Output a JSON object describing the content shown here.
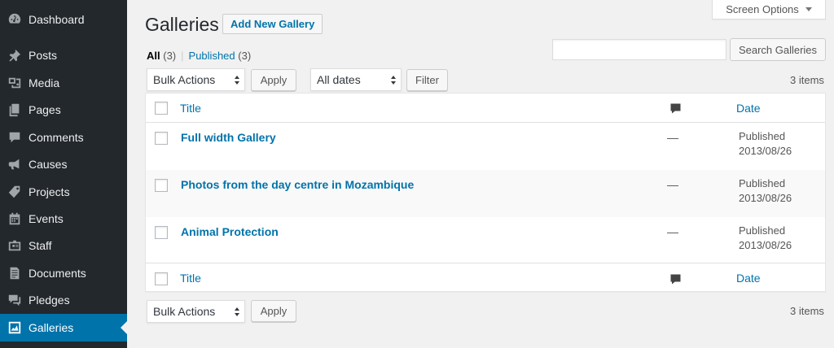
{
  "sidebar": {
    "items": [
      {
        "label": "Dashboard",
        "icon": "dashboard-icon",
        "active": false
      },
      {
        "label": "Posts",
        "icon": "pin-icon",
        "active": false
      },
      {
        "label": "Media",
        "icon": "media-icon",
        "active": false
      },
      {
        "label": "Pages",
        "icon": "pages-icon",
        "active": false
      },
      {
        "label": "Comments",
        "icon": "comment-icon",
        "active": false
      },
      {
        "label": "Causes",
        "icon": "megaphone-icon",
        "active": false
      },
      {
        "label": "Projects",
        "icon": "tag-icon",
        "active": false
      },
      {
        "label": "Events",
        "icon": "calendar-icon",
        "active": false
      },
      {
        "label": "Staff",
        "icon": "id-card-icon",
        "active": false
      },
      {
        "label": "Documents",
        "icon": "document-icon",
        "active": false
      },
      {
        "label": "Pledges",
        "icon": "chat-icon",
        "active": false
      },
      {
        "label": "Galleries",
        "icon": "chart-icon",
        "active": true
      }
    ]
  },
  "screen_options": {
    "label": "Screen Options"
  },
  "header": {
    "title": "Galleries",
    "add_new_label": "Add New Gallery"
  },
  "filters": {
    "all_label": "All",
    "all_count": "(3)",
    "separator": "|",
    "published_label": "Published",
    "published_count": "(3)"
  },
  "search": {
    "placeholder": "",
    "button_label": "Search Galleries"
  },
  "tablenav_top": {
    "bulk_actions": "Bulk Actions",
    "apply_label": "Apply",
    "dates_select": "All dates",
    "filter_label": "Filter",
    "items_count": "3 items"
  },
  "table": {
    "columns": {
      "title": "Title",
      "date": "Date"
    },
    "rows": [
      {
        "title": "Full width Gallery",
        "comments": "—",
        "status": "Published",
        "date": "2013/08/26"
      },
      {
        "title": "Photos from the day centre in Mozambique",
        "comments": "—",
        "status": "Published",
        "date": "2013/08/26"
      },
      {
        "title": "Animal Protection",
        "comments": "—",
        "status": "Published",
        "date": "2013/08/26"
      }
    ]
  },
  "tablenav_bottom": {
    "bulk_actions": "Bulk Actions",
    "apply_label": "Apply",
    "items_count": "3 items"
  },
  "colors": {
    "sidebar_bg": "#23282d",
    "accent": "#0073aa",
    "page_bg": "#f1f1f1"
  }
}
